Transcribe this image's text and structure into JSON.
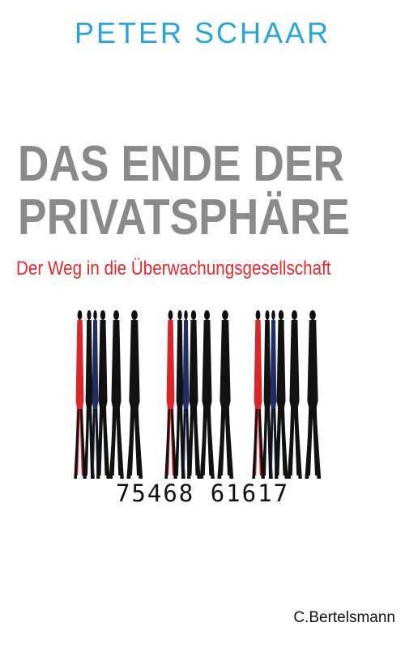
{
  "author": "PETER SCHAAR",
  "title": {
    "line1": "DAS ENDE DER",
    "line2": "PRIVATSPHÄRE"
  },
  "subtitle": "Der Weg in die Überwachungsgesellschaft",
  "barcode": {
    "number": "75468 61617",
    "figure_colors": [
      "#111111",
      "#d8262b",
      "#1f2f66"
    ]
  },
  "publisher": "C.Bertelsmann",
  "colors": {
    "author": "#27a3e0",
    "title": "#8a8a8a",
    "subtitle": "#e8262a",
    "background": "#ffffff"
  }
}
